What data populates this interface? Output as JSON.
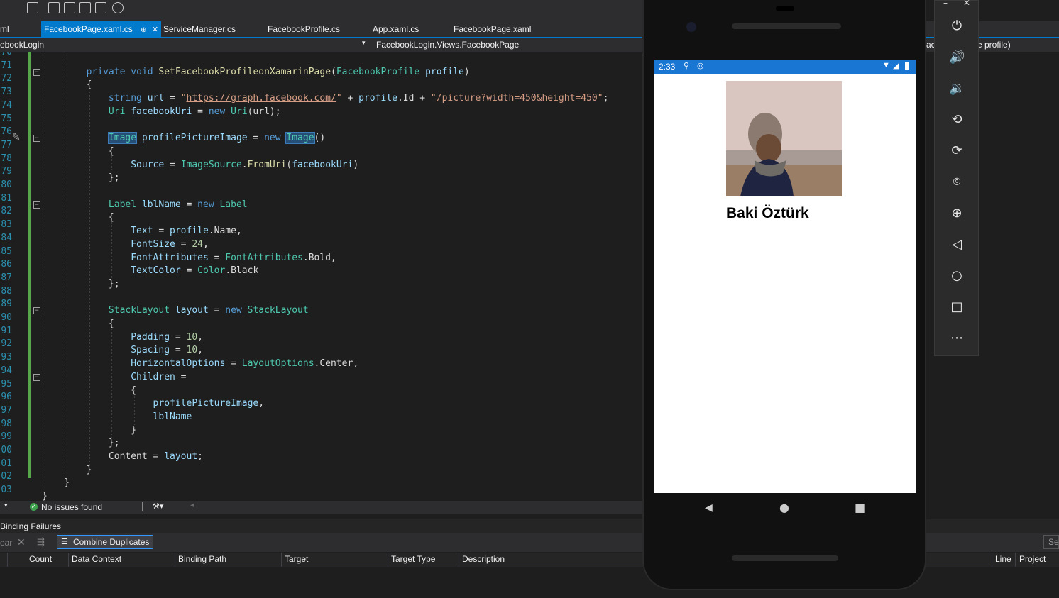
{
  "tabs": [
    {
      "label": "ml"
    },
    {
      "label": "FacebookPage.xaml.cs",
      "active": true,
      "pin": "⊕",
      "close": "✕"
    },
    {
      "label": "ServiceManager.cs"
    },
    {
      "label": "FacebookProfile.cs"
    },
    {
      "label": "App.xaml.cs"
    },
    {
      "label": "FacebookPage.xaml"
    }
  ],
  "navbar": {
    "project": "ebookLogin",
    "member": "FacebookLogin.Views.FacebookPage",
    "right_partial_a": "ac",
    "right_partial_b": "e profile)"
  },
  "line_numbers": [
    "70",
    "71",
    "72",
    "73",
    "74",
    "75",
    "76",
    "77",
    "78",
    "79",
    "80",
    "81",
    "82",
    "83",
    "84",
    "85",
    "86",
    "87",
    "88",
    "89",
    "90",
    "91",
    "92",
    "93",
    "94",
    "95",
    "96",
    "97",
    "98",
    "99",
    "00",
    "01",
    "02",
    "03"
  ],
  "code": {
    "l71": [
      "private",
      "void",
      "SetFacebookProfileonXamarinPage",
      "(",
      "FacebookProfile",
      "profile",
      ")"
    ],
    "l72": "{",
    "l73": [
      "string",
      "url",
      " = ",
      "\"",
      "https://graph.facebook.com/",
      "\"",
      " + ",
      "profile",
      ".Id + ",
      "\"/picture?width=450&height=450\"",
      ";"
    ],
    "l74": [
      "Uri",
      "facebookUri",
      " = ",
      "new",
      "Uri",
      "(url);"
    ],
    "l76": [
      "Image",
      "profilePictureImage",
      " = ",
      "new",
      "Image",
      "()"
    ],
    "l77": "{",
    "l78": [
      "Source",
      " = ",
      "ImageSource",
      ".",
      "FromUri",
      "(",
      "facebookUri",
      ")"
    ],
    "l79": "};",
    "l81": [
      "Label",
      "lblName",
      " = ",
      "new",
      "Label"
    ],
    "l82": "{",
    "l83": [
      "Text",
      " = ",
      "profile",
      ".Name,"
    ],
    "l84": [
      "FontSize",
      " = ",
      "24",
      ","
    ],
    "l85": [
      "FontAttributes",
      " = ",
      "FontAttributes",
      ".Bold,"
    ],
    "l86": [
      "TextColor",
      " = ",
      "Color",
      ".Black"
    ],
    "l87": "};",
    "l89": [
      "StackLayout",
      "layout",
      " = ",
      "new",
      "StackLayout"
    ],
    "l90": "{",
    "l91": [
      "Padding",
      " = ",
      "10",
      ","
    ],
    "l92": [
      "Spacing",
      " = ",
      "10",
      ","
    ],
    "l93": [
      "HorizontalOptions",
      " = ",
      "LayoutOptions",
      ".Center,"
    ],
    "l94": [
      "Children",
      " ="
    ],
    "l95": "{",
    "l96": [
      "profilePictureImage",
      ","
    ],
    "l97": "lblName",
    "l98": "}",
    "l99": "};",
    "l100": [
      "Content",
      " = ",
      "layout",
      ";"
    ],
    "l101": "}",
    "l102": "}",
    "l103": "}"
  },
  "status": {
    "issues": "No issues found"
  },
  "binding_panel": {
    "title": "Binding Failures",
    "clear_partial": "ear",
    "combine_button": "Combine Duplicates",
    "search_partial": "Sea",
    "columns": [
      "Count",
      "Data Context",
      "Binding Path",
      "Target",
      "Target Type",
      "Description",
      "Line",
      "Project"
    ]
  },
  "emulator": {
    "time": "2:33",
    "profile_name": "Baki Öztürk",
    "side_controls": [
      "power-icon",
      "volume-up-icon",
      "volume-down-icon",
      "rotate-left-icon",
      "rotate-right-icon",
      "camera-icon",
      "zoom-icon",
      "back-icon",
      "home-icon",
      "overview-icon",
      "more-icon"
    ],
    "window_controls": {
      "minimize": "–",
      "close": "✕"
    },
    "nav": {
      "back": "◀",
      "home": "●",
      "recent": "■"
    }
  }
}
